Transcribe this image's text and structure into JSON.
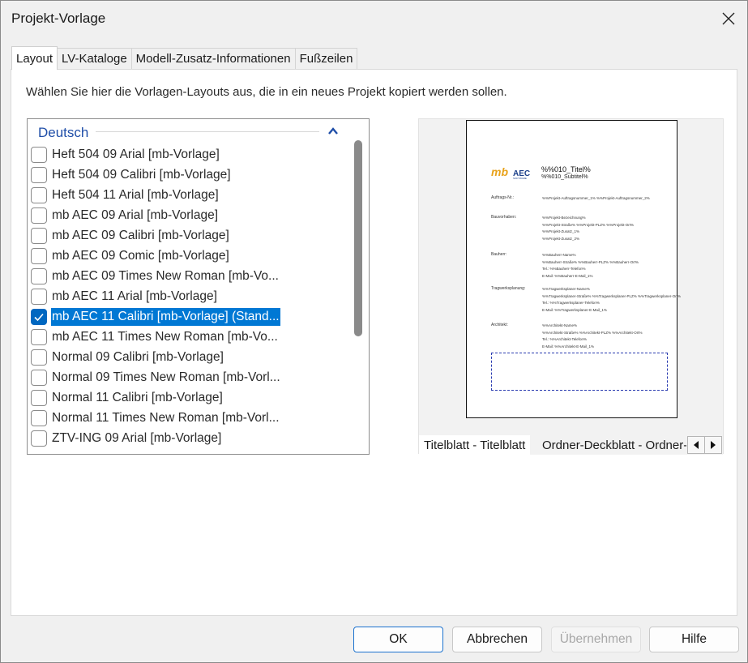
{
  "window": {
    "title": "Projekt-Vorlage"
  },
  "tabs": [
    "Layout",
    "LV-Kataloge",
    "Modell-Zusatz-Informationen",
    "Fußzeilen"
  ],
  "layout": {
    "instruction": "Wählen Sie hier die Vorlagen-Layouts aus, die in ein neues Projekt kopiert werden sollen.",
    "group": "Deutsch",
    "items": [
      {
        "label": "Heft 504 09 Arial [mb-Vorlage]",
        "checked": false
      },
      {
        "label": "Heft 504 09 Calibri [mb-Vorlage]",
        "checked": false
      },
      {
        "label": "Heft 504 11 Arial [mb-Vorlage]",
        "checked": false
      },
      {
        "label": "mb AEC 09 Arial [mb-Vorlage]",
        "checked": false
      },
      {
        "label": "mb AEC 09 Calibri [mb-Vorlage]",
        "checked": false
      },
      {
        "label": "mb AEC 09 Comic [mb-Vorlage]",
        "checked": false
      },
      {
        "label": "mb AEC 09 Times New Roman [mb-Vo...",
        "checked": false
      },
      {
        "label": "mb AEC 11 Arial [mb-Vorlage]",
        "checked": false
      },
      {
        "label": "mb AEC 11 Calibri [mb-Vorlage] (Stand...",
        "checked": true,
        "selected": true
      },
      {
        "label": "mb AEC 11 Times New Roman [mb-Vo...",
        "checked": false
      },
      {
        "label": "Normal 09 Calibri [mb-Vorlage]",
        "checked": false
      },
      {
        "label": "Normal 09 Times New Roman [mb-Vorl...",
        "checked": false
      },
      {
        "label": "Normal 11 Calibri [mb-Vorlage]",
        "checked": false
      },
      {
        "label": "Normal 11 Times New Roman [mb-Vorl...",
        "checked": false
      },
      {
        "label": "ZTV-ING 09 Arial [mb-Vorlage]",
        "checked": false
      }
    ]
  },
  "preview": {
    "logo_text": "mbAEC",
    "title": "%%010_Titel%",
    "subtitle": "%%010_Subtitel%",
    "rows": [
      {
        "label": "Auftrags-Nr.:",
        "values": [
          "%%Projekt-Auftragsnummer_1% %%Projekt-Auftragsnummer_2%"
        ]
      },
      {
        "label": "Bauvorhaben:",
        "values": [
          "%%Projekt-Bezeichnung%",
          "%%Projekt-Straße% %%Projekt-PLZ% %%Projekt-Ort%",
          "%%Projekt-Zusatz_1%",
          "%%Projekt-Zusatz_2%"
        ]
      },
      {
        "label": "Bauherr:",
        "values": [
          "%%Bauherr-Name%",
          "%%Bauherr-Straße% %%Bauherr-PLZ% %%Bauherr-Ort%",
          "Tel.: %%Bauherr-Telefon%",
          "E-Mail: %%Bauherr-E-Mail_1%"
        ]
      },
      {
        "label": "Tragwerksplanung:",
        "values": [
          "%%Tragwerksplaner-Name%",
          "%%Tragwerksplaner-Straße% %%Tragwerksplaner-PLZ% %%Tragwerksplaner-Ort%",
          "Tel.: %%Tragwerksplaner-Telefon%",
          "E-Mail: %%Tragwerksplaner-E-Mail_1%"
        ]
      },
      {
        "label": "Architekt:",
        "values": [
          "%%Architekt-Name%",
          "%%Architekt-Straße% %%Architekt-PLZ% %%Architekt-Ort%",
          "Tel.: %%Architekt-Telefon%",
          "E-Mail: %%Architekt-E-Mail_1%"
        ]
      }
    ],
    "tabs": [
      "Titelblatt - Titelblatt",
      "Ordner-Deckblatt - Ordner-Deckblatt"
    ]
  },
  "buttons": {
    "ok": "OK",
    "cancel": "Abbrechen",
    "apply": "Übernehmen",
    "help": "Hilfe"
  },
  "colors": {
    "accent": "#0078d4",
    "group_title": "#1f4ea8"
  }
}
